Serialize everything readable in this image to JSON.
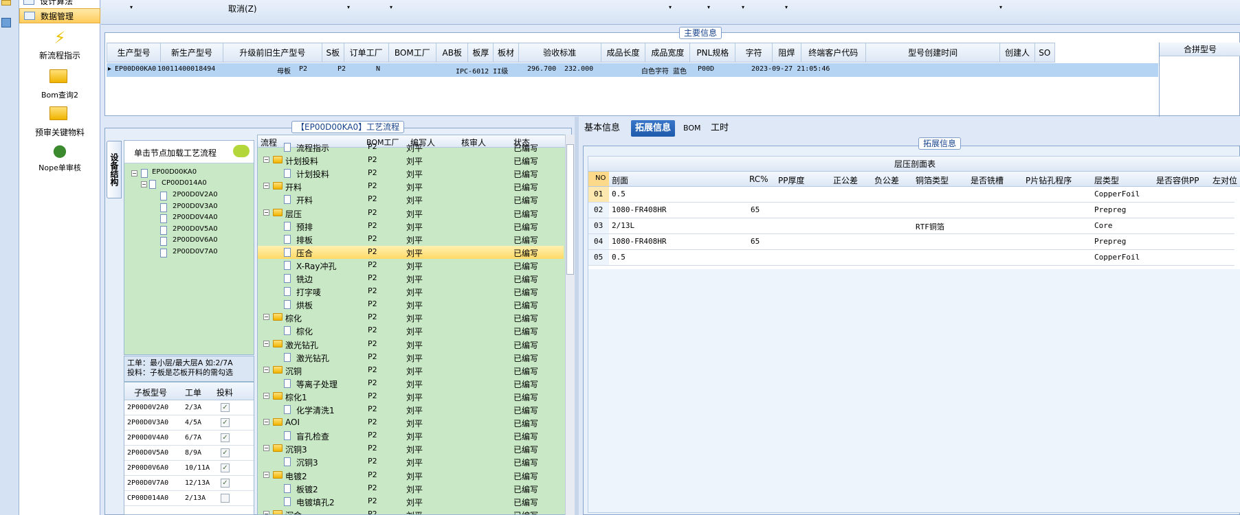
{
  "nav": {
    "top_item": "设计算法",
    "selected_item": "数据管理",
    "items": [
      {
        "label": "新流程指示"
      },
      {
        "label": "Bom查询2"
      },
      {
        "label": "预审关键物料"
      },
      {
        "label": "Nope单审核"
      }
    ]
  },
  "toolbar": {
    "cancel_label": "取消(Z)"
  },
  "main_info": {
    "title": "主要信息",
    "columns": [
      "生产型号",
      "新生产型号",
      "升级前旧生产型号",
      "S板",
      "订单工厂",
      "BOM工厂",
      "AB板",
      "板厚",
      "板材",
      "验收标准",
      "成品长度",
      "成品宽度",
      "PNL规格",
      "字符",
      "阻焊",
      "终端客户代码",
      "型号创建时间",
      "创建人",
      "SO"
    ],
    "row": {
      "prod_model": "EP00D00KA0",
      "new_model": "10011400018494",
      "s_board": "母板",
      "order_factory": "P2",
      "bom_factory": "P2",
      "ab_board": "N",
      "acceptance": "IPC-6012 II级",
      "length": "296.700",
      "width": "232.000",
      "char": "白色字符",
      "solder": "蓝色",
      "customer": "P00D",
      "created": "2023-09-27 21:05:46"
    },
    "merge_header": "合拼型号"
  },
  "process": {
    "title": "【EP00D00KA0】工艺流程",
    "side_tab": "设备结构",
    "hint": "单击节点加载工艺流程",
    "tree": {
      "root": "EP00D00KA0",
      "child": "CP00D014A0",
      "leaves": [
        "2P00D0V2A0",
        "2P00D0V3A0",
        "2P00D0V4A0",
        "2P00D0V5A0",
        "2P00D0V6A0",
        "2P00D0V7A0"
      ]
    },
    "note1": "工单：最小层/最大层A 如:2/7A",
    "note2": "投料：子板是芯板开料的需勾选",
    "sub_table": {
      "headers": [
        "子板型号",
        "工单",
        "投料"
      ],
      "rows": [
        {
          "model": "2P00D0V2A0",
          "order": "2/3A",
          "feed": true
        },
        {
          "model": "2P00D0V3A0",
          "order": "4/5A",
          "feed": true
        },
        {
          "model": "2P00D0V4A0",
          "order": "6/7A",
          "feed": true
        },
        {
          "model": "2P00D0V5A0",
          "order": "8/9A",
          "feed": true
        },
        {
          "model": "2P00D0V6A0",
          "order": "10/11A",
          "feed": true
        },
        {
          "model": "2P00D0V7A0",
          "order": "12/13A",
          "feed": true
        },
        {
          "model": "CP00D014A0",
          "order": "2/13A",
          "feed": false
        }
      ]
    },
    "flow_headers": [
      "流程",
      "BOM工厂",
      "编写人",
      "核审人",
      "状态"
    ],
    "flow_rows": [
      {
        "name": "流程指示",
        "lvl": 2,
        "folder": false
      },
      {
        "name": "计划投料",
        "lvl": 1,
        "folder": true
      },
      {
        "name": "计划投料",
        "lvl": 2,
        "folder": false
      },
      {
        "name": "开料",
        "lvl": 1,
        "folder": true
      },
      {
        "name": "开料",
        "lvl": 2,
        "folder": false
      },
      {
        "name": "层压",
        "lvl": 1,
        "folder": true
      },
      {
        "name": "预排",
        "lvl": 2,
        "folder": false
      },
      {
        "name": "排板",
        "lvl": 2,
        "folder": false
      },
      {
        "name": "压合",
        "lvl": 2,
        "folder": false,
        "hl": true
      },
      {
        "name": "X-Ray冲孔",
        "lvl": 2,
        "folder": false
      },
      {
        "name": "铣边",
        "lvl": 2,
        "folder": false
      },
      {
        "name": "打字唛",
        "lvl": 2,
        "folder": false
      },
      {
        "name": "烘板",
        "lvl": 2,
        "folder": false
      },
      {
        "name": "棕化",
        "lvl": 1,
        "folder": true
      },
      {
        "name": "棕化",
        "lvl": 2,
        "folder": false
      },
      {
        "name": "激光钻孔",
        "lvl": 1,
        "folder": true
      },
      {
        "name": "激光钻孔",
        "lvl": 2,
        "folder": false
      },
      {
        "name": "沉铜",
        "lvl": 1,
        "folder": true
      },
      {
        "name": "等离子处理",
        "lvl": 2,
        "folder": false
      },
      {
        "name": "棕化1",
        "lvl": 1,
        "folder": true
      },
      {
        "name": "化学清洗1",
        "lvl": 2,
        "folder": false
      },
      {
        "name": "AOI",
        "lvl": 1,
        "folder": true
      },
      {
        "name": "盲孔检查",
        "lvl": 2,
        "folder": false
      },
      {
        "name": "沉铜3",
        "lvl": 1,
        "folder": true
      },
      {
        "name": "沉铜3",
        "lvl": 2,
        "folder": false
      },
      {
        "name": "电镀2",
        "lvl": 1,
        "folder": true
      },
      {
        "name": "板镀2",
        "lvl": 2,
        "folder": false
      },
      {
        "name": "电镀填孔2",
        "lvl": 2,
        "folder": false
      },
      {
        "name": "沉金",
        "lvl": 1,
        "folder": true
      }
    ],
    "flow_common": {
      "factory": "P2",
      "writer": "刘平",
      "status": "已编写"
    }
  },
  "detail": {
    "tabs": [
      "基本信息",
      "拓展信息",
      "BOM",
      "工时"
    ],
    "group_title": "拓展信息",
    "table_title": "层压剖面表",
    "headers": [
      "NO",
      "剖面",
      "RC%",
      "PP厚度",
      "正公差",
      "负公差",
      "铜箔类型",
      "是否铣槽",
      "P片钻孔程序",
      "层类型",
      "是否容供PP",
      "左对位"
    ],
    "rows": [
      {
        "no": "01",
        "section": "0.5",
        "rc": "",
        "foil": "",
        "layer": "CopperFoil"
      },
      {
        "no": "02",
        "section": "1080-FR408HR",
        "rc": "65",
        "foil": "",
        "layer": "Prepreg"
      },
      {
        "no": "03",
        "section": "2/13L",
        "rc": "",
        "foil": "RTF铜箔",
        "layer": "Core"
      },
      {
        "no": "04",
        "section": "1080-FR408HR",
        "rc": "65",
        "foil": "",
        "layer": "Prepreg"
      },
      {
        "no": "05",
        "section": "0.5",
        "rc": "",
        "foil": "",
        "layer": "CopperFoil"
      }
    ]
  }
}
